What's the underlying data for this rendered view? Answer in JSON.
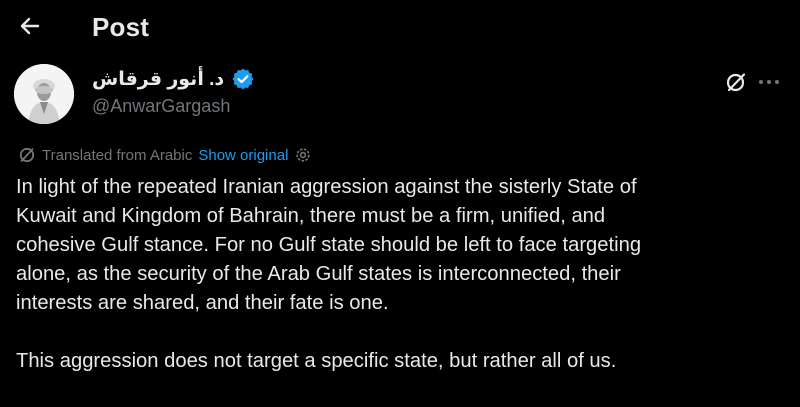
{
  "header": {
    "title": "Post"
  },
  "author": {
    "name": "د. أنور قرقاش",
    "handle": "@AnwarGargash",
    "verified": true
  },
  "translation": {
    "label": "Translated from Arabic",
    "show_original_label": "Show original"
  },
  "post": {
    "paragraphs": [
      "In light of the repeated Iranian aggression against the sisterly State of\nKuwait and Kingdom of Bahrain, there must be a firm, unified, and\ncohesive Gulf stance. For no Gulf state should be left to face targeting\nalone, as the security of the Arab Gulf states is interconnected, their\ninterests are shared, and their fate is one.",
      "This aggression does not target a specific state, but rather all of us."
    ]
  },
  "colors": {
    "background": "#000000",
    "text_primary": "#e7e9ea",
    "text_secondary": "#71767b",
    "accent": "#1d9bf0"
  },
  "icons": {
    "back": "arrow-left-icon",
    "verified": "verified-badge-icon",
    "grok": "grok-icon",
    "more": "more-horizontal-icon",
    "translate": "translate-icon",
    "settings": "gear-icon"
  }
}
